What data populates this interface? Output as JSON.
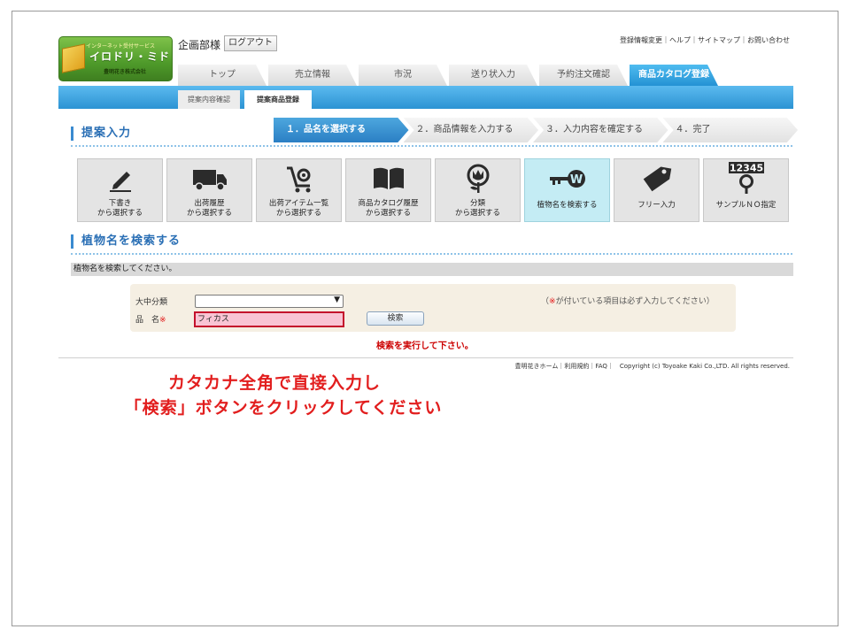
{
  "header": {
    "logo": {
      "subtitle": "インターネット受付サービス",
      "name": "イロドリ・ミドリ",
      "company": "豊明花き株式会社"
    },
    "user_name": "企画部様",
    "logout_label": "ログアウト",
    "util_links": "登録情報変更｜ヘルプ｜サイトマップ｜お問い合わせ"
  },
  "tabs": [
    {
      "label": "トップ"
    },
    {
      "label": "売立情報"
    },
    {
      "label": "市況"
    },
    {
      "label": "送り状入力"
    },
    {
      "label": "予約注文確認"
    },
    {
      "label": "商品カタログ登録",
      "active": true
    }
  ],
  "subtabs": [
    {
      "label": "提案内容確認"
    },
    {
      "label": "提案商品登録",
      "active": true
    }
  ],
  "proposal": {
    "title": "提案入力"
  },
  "steps": [
    {
      "label": "１．品名を選択する",
      "active": true
    },
    {
      "label": "２．商品情報を入力する"
    },
    {
      "label": "３．入力内容を確定する"
    },
    {
      "label": "４．完了"
    }
  ],
  "select_buttons": [
    {
      "label": "下書き\nから選択する",
      "icon": "pencil-icon"
    },
    {
      "label": "出荷履歴\nから選択する",
      "icon": "truck-icon"
    },
    {
      "label": "出荷アイテム一覧\nから選択する",
      "icon": "cart-flower-icon"
    },
    {
      "label": "商品カタログ履歴\nから選択する",
      "icon": "book-icon"
    },
    {
      "label": "分類\nから選択する",
      "icon": "flower-icon"
    },
    {
      "label": "植物名を検索する",
      "icon": "key-icon",
      "active": true
    },
    {
      "label": "フリー入力",
      "icon": "tag-icon"
    },
    {
      "label": "サンプルＮＯ指定",
      "icon": "number-search-icon",
      "badge": "12345"
    }
  ],
  "search": {
    "title": "植物名を検索する",
    "info": "植物名を検索してください。",
    "category_label": "大中分類",
    "category_value": "",
    "name_label": "品　名",
    "required_mark": "※",
    "name_value": "フィカス",
    "button_label": "検索",
    "required_note_prefix": "（",
    "required_note_suffix": "が付いている項目は必ず入力してください）",
    "exec_message": "検索を実行して下さい。"
  },
  "footer": {
    "text": "豊明花きホーム｜利用規約｜FAQ｜　Copyright (c) Toyoake Kaki Co.,LTD. All rights reserved."
  },
  "instruction": {
    "line1": "カタカナ全角で直接入力し",
    "line2": "「検索」ボタンをクリックしてください"
  },
  "colors": {
    "accent_blue": "#2b8fd2",
    "active_tile": "#c4ecf4",
    "instruction_red": "#e21e1e",
    "input_highlight": "#f9c4d4"
  }
}
